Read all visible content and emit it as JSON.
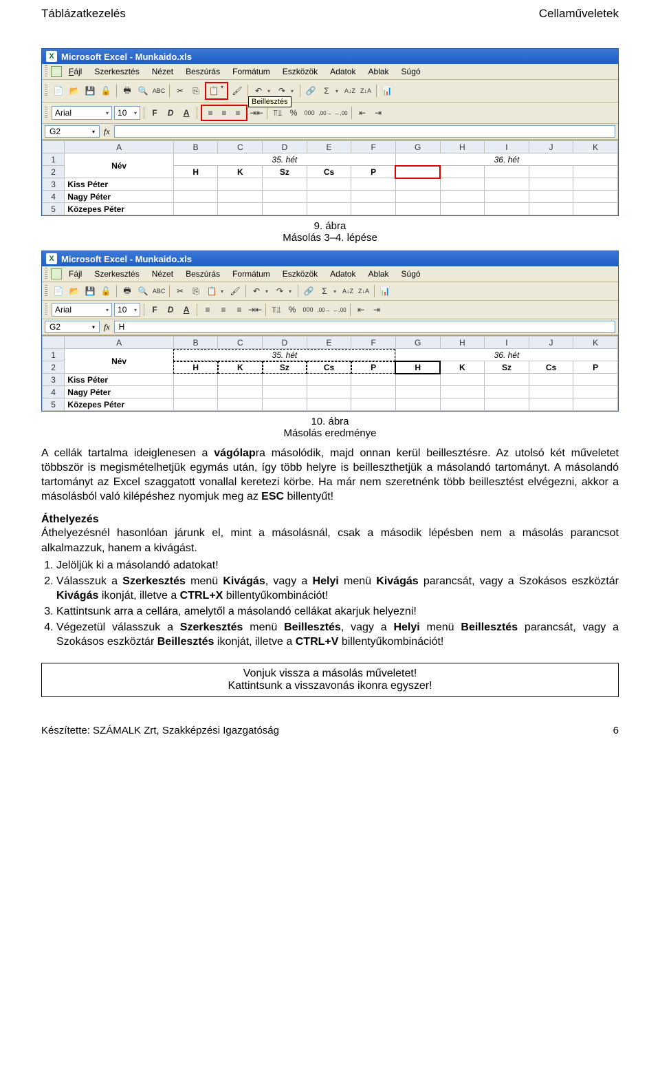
{
  "header": {
    "left": "Táblázatkezelés",
    "right": "Cellaműveletek"
  },
  "excel": {
    "title": "Microsoft Excel - Munkaido.xls",
    "menu": {
      "file": "Fájl",
      "edit": "Szerkesztés",
      "view": "Nézet",
      "insert": "Beszúrás",
      "format": "Formátum",
      "tools": "Eszközök",
      "data": "Adatok",
      "window": "Ablak",
      "help": "Súgó"
    },
    "tooltip_paste": "Beillesztés",
    "font_name": "Arial",
    "font_size": "10",
    "bold": "F",
    "italic": "D",
    "underline": "A",
    "sigma": "Σ",
    "namebox1": "G2",
    "namebox2": "G2",
    "fx": "fx",
    "formula2": "H",
    "decimals": {
      "comma": ",",
      "inc": ",00",
      "dec": ",00"
    },
    "cols": [
      "A",
      "B",
      "C",
      "D",
      "E",
      "F",
      "G",
      "H",
      "I",
      "J",
      "K"
    ],
    "rows_label": [
      "1",
      "2",
      "3",
      "4",
      "5"
    ],
    "data1": {
      "name_header": "Név",
      "week35": "35. hét",
      "week36": "36. hét",
      "days1": [
        "H",
        "K",
        "Sz",
        "Cs",
        "P"
      ],
      "names": [
        "Kiss Péter",
        "Nagy Péter",
        "Közepes Péter"
      ]
    },
    "data2": {
      "name_header": "Név",
      "week35": "35. hét",
      "week36": "36. hét",
      "days1": [
        "H",
        "K",
        "Sz",
        "Cs",
        "P"
      ],
      "days2": [
        "H",
        "K",
        "Sz",
        "Cs",
        "P"
      ],
      "names": [
        "Kiss Péter",
        "Nagy Péter",
        "Közepes Péter"
      ]
    }
  },
  "captions": {
    "c1a": "9. ábra",
    "c1b": "Másolás 3–4. lépése",
    "c2a": "10. ábra",
    "c2b": "Másolás eredménye"
  },
  "para1_a": "A cellák tartalma ideiglenesen a ",
  "para1_b": "vágólap",
  "para1_c": "ra másolódik, majd onnan kerül beillesztésre. Az utolsó két műveletet többször is megismételhetjük egymás után, így több helyre is beilleszthetjük a másolandó tartományt. A másolandó tartományt az Excel szaggatott vonallal keretezi körbe. Ha már nem szeretnénk több beillesztést elvégezni, akkor a másolásból való kilépéshez nyomjuk meg az ",
  "para1_d": "ESC",
  "para1_e": " billentyűt!",
  "sect_move": "Áthelyezés",
  "para2": "Áthelyezésnél hasonlóan járunk el, mint a másolásnál, csak a második lépésben nem a másolás parancsot alkalmazzuk, hanem a kivágást.",
  "steps": {
    "s1": "Jelöljük ki a másolandó adatokat!",
    "s2a": "Válasszuk a ",
    "s2b": "Szerkesztés",
    "s2c": " menü ",
    "s2d": "Kivágás",
    "s2e": ", vagy a ",
    "s2f": "Helyi",
    "s2g": " menü ",
    "s2h": "Kivágás",
    "s2i": " parancsát, vagy a Szokásos eszköztár ",
    "s2j": "Kivágás",
    "s2k": " ikonját, illetve a ",
    "s2l": "CTRL+X",
    "s2m": " billentyűkombinációt!",
    "s3": "Kattintsunk arra a cellára, amelytől a másolandó cellákat akarjuk helyezni!",
    "s4a": "Végezetül válasszuk a ",
    "s4b": "Szerkesztés",
    "s4c": " menü ",
    "s4d": "Beillesztés",
    "s4e": ", vagy a ",
    "s4f": "Helyi",
    "s4g": " menü ",
    "s4h": "Beillesztés",
    "s4i": " parancsát, vagy a Szokásos eszköztár ",
    "s4j": "Beillesztés",
    "s4k": " ikonját, illetve a ",
    "s4l": "CTRL+V",
    "s4m": " billentyűkombinációt!"
  },
  "task": {
    "line1": "Vonjuk vissza a másolás műveletet!",
    "line2": "Kattintsunk a visszavonás ikonra egyszer!"
  },
  "footer": {
    "left": "Készítette: SZÁMALK Zrt, Szakképzési Igazgatóság",
    "page": "6"
  }
}
